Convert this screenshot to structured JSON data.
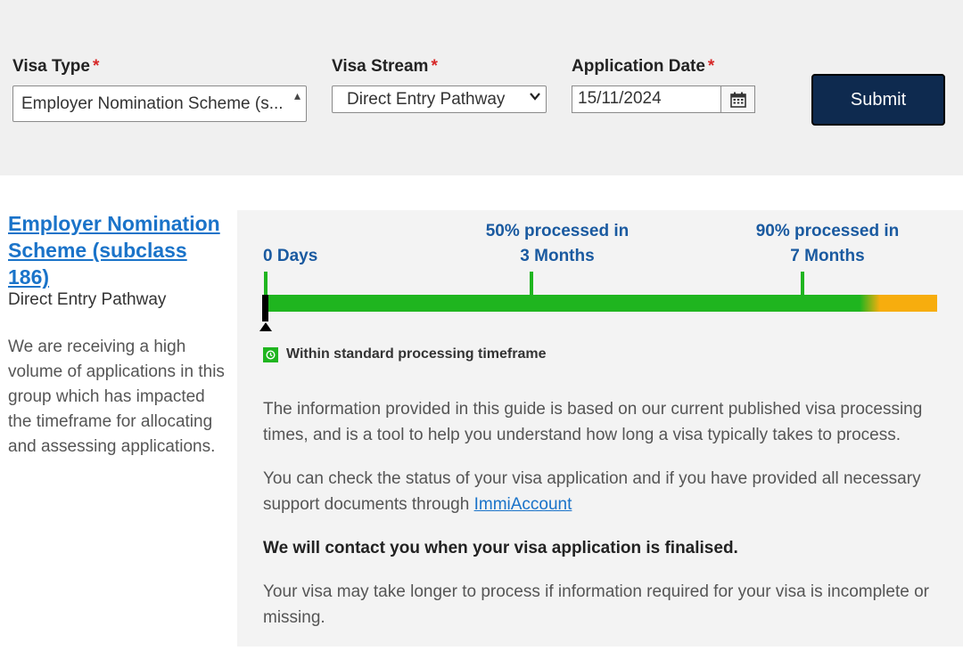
{
  "form": {
    "visa_type": {
      "label": "Visa Type",
      "required_mark": "*",
      "value": "Employer Nomination Scheme (s..."
    },
    "visa_stream": {
      "label": "Visa Stream",
      "required_mark": "*",
      "value": "Direct Entry Pathway"
    },
    "application_date": {
      "label": "Application Date",
      "required_mark": "*",
      "value": "15/11/2024"
    },
    "submit_label": "Submit"
  },
  "result": {
    "visa_title": "Employer Nomination Scheme (subclass 186)",
    "stream": "Direct Entry Pathway",
    "notice": "We are receiving a high volume of applications in this group which has impacted the timeframe for allocating and assessing applications."
  },
  "timeline": {
    "start_label": "0 Days",
    "fifty": {
      "line1": "50% processed in",
      "line2": "3 Months"
    },
    "ninety": {
      "line1": "90% processed in",
      "line2": "7 Months"
    },
    "colors": {
      "within": "#1fb51f",
      "beyond": "#f7ad0e",
      "marker": "#000000"
    },
    "legend_icon": "clock-icon",
    "legend_text": "Within standard processing timeframe"
  },
  "info": {
    "p1": "The information provided in this guide is based on our current published visa processing times, and is a tool to help you understand how long a visa typically takes to process.",
    "p2_text": "You can check the status of your visa application and if you have provided all necessary support documents through ",
    "p2_link": "ImmiAccount",
    "p3": "We will contact you when your visa application is finalised.",
    "p4": "Your visa may take longer to process if information required for your visa is incomplete or missing."
  },
  "icons": {
    "calendar": "calendar-icon",
    "dropdown": "chevron-down-icon"
  }
}
